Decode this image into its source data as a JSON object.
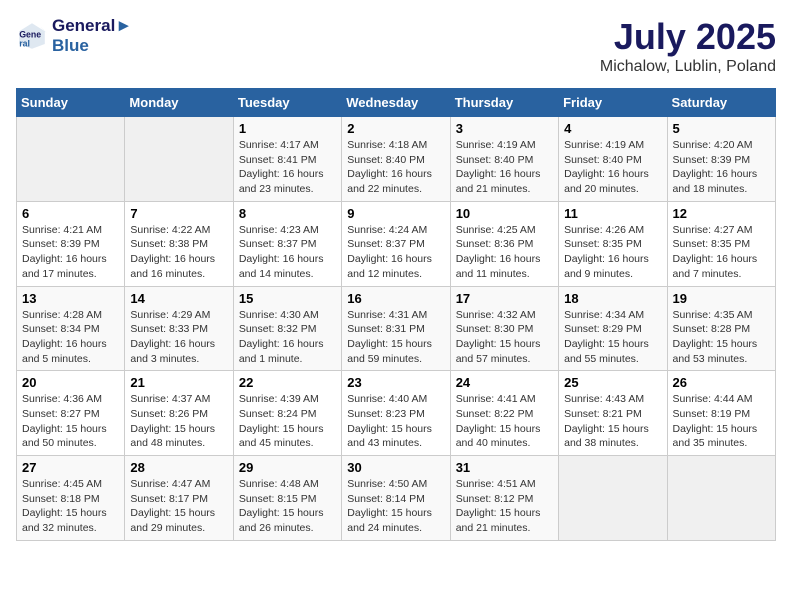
{
  "header": {
    "logo_line1": "General",
    "logo_line2": "Blue",
    "month_year": "July 2025",
    "location": "Michalow, Lublin, Poland"
  },
  "weekdays": [
    "Sunday",
    "Monday",
    "Tuesday",
    "Wednesday",
    "Thursday",
    "Friday",
    "Saturday"
  ],
  "weeks": [
    [
      {
        "day": "",
        "info": ""
      },
      {
        "day": "",
        "info": ""
      },
      {
        "day": "1",
        "info": "Sunrise: 4:17 AM\nSunset: 8:41 PM\nDaylight: 16 hours and 23 minutes."
      },
      {
        "day": "2",
        "info": "Sunrise: 4:18 AM\nSunset: 8:40 PM\nDaylight: 16 hours and 22 minutes."
      },
      {
        "day": "3",
        "info": "Sunrise: 4:19 AM\nSunset: 8:40 PM\nDaylight: 16 hours and 21 minutes."
      },
      {
        "day": "4",
        "info": "Sunrise: 4:19 AM\nSunset: 8:40 PM\nDaylight: 16 hours and 20 minutes."
      },
      {
        "day": "5",
        "info": "Sunrise: 4:20 AM\nSunset: 8:39 PM\nDaylight: 16 hours and 18 minutes."
      }
    ],
    [
      {
        "day": "6",
        "info": "Sunrise: 4:21 AM\nSunset: 8:39 PM\nDaylight: 16 hours and 17 minutes."
      },
      {
        "day": "7",
        "info": "Sunrise: 4:22 AM\nSunset: 8:38 PM\nDaylight: 16 hours and 16 minutes."
      },
      {
        "day": "8",
        "info": "Sunrise: 4:23 AM\nSunset: 8:37 PM\nDaylight: 16 hours and 14 minutes."
      },
      {
        "day": "9",
        "info": "Sunrise: 4:24 AM\nSunset: 8:37 PM\nDaylight: 16 hours and 12 minutes."
      },
      {
        "day": "10",
        "info": "Sunrise: 4:25 AM\nSunset: 8:36 PM\nDaylight: 16 hours and 11 minutes."
      },
      {
        "day": "11",
        "info": "Sunrise: 4:26 AM\nSunset: 8:35 PM\nDaylight: 16 hours and 9 minutes."
      },
      {
        "day": "12",
        "info": "Sunrise: 4:27 AM\nSunset: 8:35 PM\nDaylight: 16 hours and 7 minutes."
      }
    ],
    [
      {
        "day": "13",
        "info": "Sunrise: 4:28 AM\nSunset: 8:34 PM\nDaylight: 16 hours and 5 minutes."
      },
      {
        "day": "14",
        "info": "Sunrise: 4:29 AM\nSunset: 8:33 PM\nDaylight: 16 hours and 3 minutes."
      },
      {
        "day": "15",
        "info": "Sunrise: 4:30 AM\nSunset: 8:32 PM\nDaylight: 16 hours and 1 minute."
      },
      {
        "day": "16",
        "info": "Sunrise: 4:31 AM\nSunset: 8:31 PM\nDaylight: 15 hours and 59 minutes."
      },
      {
        "day": "17",
        "info": "Sunrise: 4:32 AM\nSunset: 8:30 PM\nDaylight: 15 hours and 57 minutes."
      },
      {
        "day": "18",
        "info": "Sunrise: 4:34 AM\nSunset: 8:29 PM\nDaylight: 15 hours and 55 minutes."
      },
      {
        "day": "19",
        "info": "Sunrise: 4:35 AM\nSunset: 8:28 PM\nDaylight: 15 hours and 53 minutes."
      }
    ],
    [
      {
        "day": "20",
        "info": "Sunrise: 4:36 AM\nSunset: 8:27 PM\nDaylight: 15 hours and 50 minutes."
      },
      {
        "day": "21",
        "info": "Sunrise: 4:37 AM\nSunset: 8:26 PM\nDaylight: 15 hours and 48 minutes."
      },
      {
        "day": "22",
        "info": "Sunrise: 4:39 AM\nSunset: 8:24 PM\nDaylight: 15 hours and 45 minutes."
      },
      {
        "day": "23",
        "info": "Sunrise: 4:40 AM\nSunset: 8:23 PM\nDaylight: 15 hours and 43 minutes."
      },
      {
        "day": "24",
        "info": "Sunrise: 4:41 AM\nSunset: 8:22 PM\nDaylight: 15 hours and 40 minutes."
      },
      {
        "day": "25",
        "info": "Sunrise: 4:43 AM\nSunset: 8:21 PM\nDaylight: 15 hours and 38 minutes."
      },
      {
        "day": "26",
        "info": "Sunrise: 4:44 AM\nSunset: 8:19 PM\nDaylight: 15 hours and 35 minutes."
      }
    ],
    [
      {
        "day": "27",
        "info": "Sunrise: 4:45 AM\nSunset: 8:18 PM\nDaylight: 15 hours and 32 minutes."
      },
      {
        "day": "28",
        "info": "Sunrise: 4:47 AM\nSunset: 8:17 PM\nDaylight: 15 hours and 29 minutes."
      },
      {
        "day": "29",
        "info": "Sunrise: 4:48 AM\nSunset: 8:15 PM\nDaylight: 15 hours and 26 minutes."
      },
      {
        "day": "30",
        "info": "Sunrise: 4:50 AM\nSunset: 8:14 PM\nDaylight: 15 hours and 24 minutes."
      },
      {
        "day": "31",
        "info": "Sunrise: 4:51 AM\nSunset: 8:12 PM\nDaylight: 15 hours and 21 minutes."
      },
      {
        "day": "",
        "info": ""
      },
      {
        "day": "",
        "info": ""
      }
    ]
  ]
}
